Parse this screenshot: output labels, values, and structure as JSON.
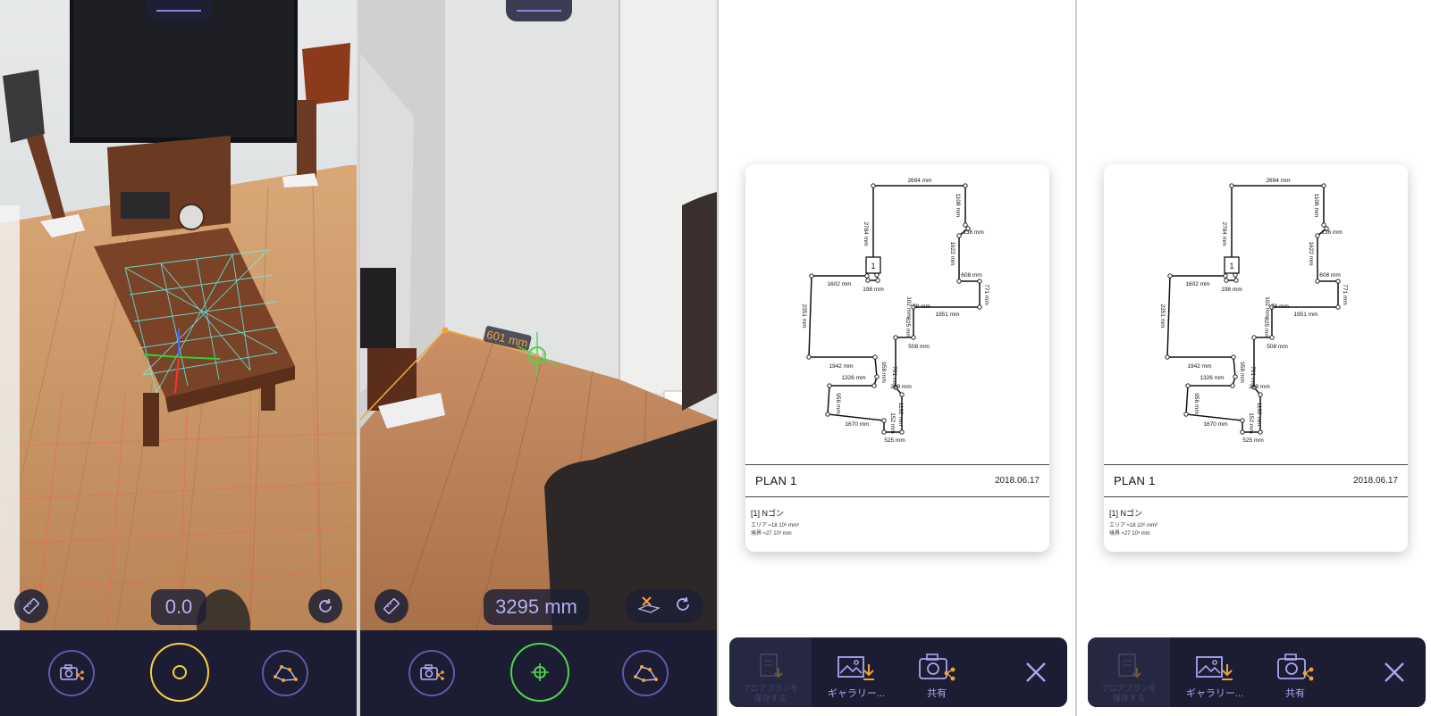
{
  "screens": {
    "scan": {
      "readout": "0.0",
      "colors": {
        "shutter_ring": "#f5d142",
        "accent": "#f0a33a",
        "icon": "#b4b0f2"
      }
    },
    "measure": {
      "readout": "3295 mm",
      "segment_label": "601 mm",
      "colors": {
        "shutter_ring": "#4cd64c",
        "line": "#f0a33a"
      }
    }
  },
  "plan": {
    "title": "PLAN 1",
    "date": "2018.06.17",
    "polygon_title": "[1] Nゴン",
    "area_text": "エリア ≈18 10⁶ mm²",
    "perimeter_text": "境界 ≈27 10³ mm",
    "marker_label": "1",
    "dimensions": [
      "2694 mm",
      "2784 mm",
      "1108 mm",
      "136 mm",
      "1622 mm",
      "608 mm",
      "771 mm",
      "1951 mm",
      "1602 mm",
      "198 mm",
      "2351 mm",
      "102 mm",
      "78 mm",
      "825 mm",
      "508 mm",
      "1942 mm",
      "1326 mm",
      "958 mm",
      "701 mm",
      "259 mm",
      "956 mm",
      "1670 mm",
      "1192 mm",
      "152 mm",
      "525 mm"
    ]
  },
  "actions": {
    "save_plan": "フロアプランを保存する",
    "gallery": "ギャラリー...",
    "share": "共有"
  },
  "icons": {
    "ruler": "ruler-icon",
    "rotate": "rotate-icon",
    "camera_share": "camera-share-icon",
    "polygon": "polygon-icon",
    "crosshair": "crosshair-icon",
    "floor_reset": "floor-reset-icon",
    "close": "close-icon"
  }
}
